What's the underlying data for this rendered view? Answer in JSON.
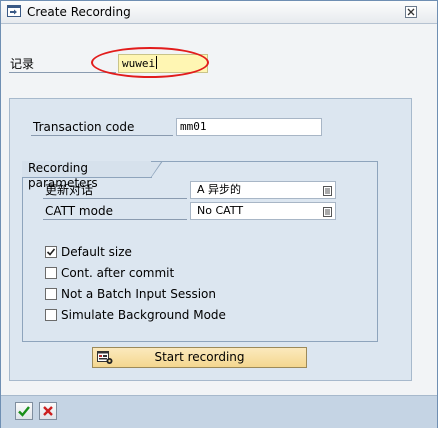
{
  "window": {
    "title": "Create Recording",
    "title_icon": "window-icon",
    "close_icon": "close-icon"
  },
  "record": {
    "label": "记录",
    "value": "wuwei"
  },
  "transaction": {
    "label": "Transaction code",
    "value": "mm01"
  },
  "recording_parameters": {
    "title": "Recording parameters",
    "update_dialog": {
      "label": "更新对话",
      "value": "A 异步的"
    },
    "catt_mode": {
      "label": "CATT mode",
      "value": "No CATT"
    },
    "checkboxes": [
      {
        "label": "Default size",
        "checked": true
      },
      {
        "label": "Cont. after commit",
        "checked": false
      },
      {
        "label": "Not a Batch Input Session",
        "checked": false
      },
      {
        "label": "Simulate Background Mode",
        "checked": false
      }
    ]
  },
  "start_button": {
    "label": "Start recording",
    "icon": "recording-icon"
  },
  "footer": {
    "confirm_icon": "checkmark-icon",
    "cancel_icon": "cancel-icon"
  },
  "colors": {
    "highlight": "#e21c1c",
    "input_active": "#fff6b3",
    "panel": "#dce6f0",
    "button": "#f4d78f",
    "confirm": "#1a8f1a",
    "cancel": "#cc1f1f"
  }
}
